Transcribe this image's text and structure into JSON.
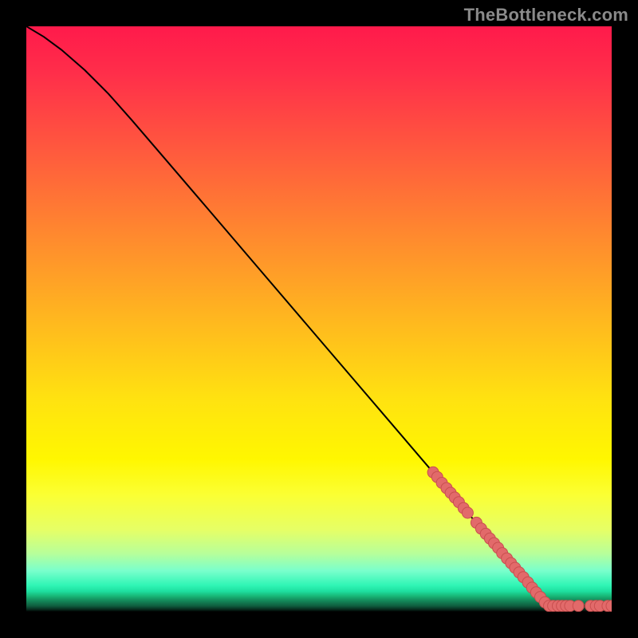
{
  "attribution": "TheBottleneck.com",
  "colors": {
    "marker_fill": "#e26a6a",
    "marker_stroke": "#c94f4f",
    "curve": "#000000",
    "page_bg": "#000000"
  },
  "chart_data": {
    "type": "line",
    "title": "",
    "xlabel": "",
    "ylabel": "",
    "xlim": [
      0,
      100
    ],
    "ylim": [
      0,
      100
    ],
    "grid": false,
    "legend": false,
    "curve": [
      {
        "x": 0,
        "y": 100
      },
      {
        "x": 3,
        "y": 98.2
      },
      {
        "x": 6,
        "y": 96.0
      },
      {
        "x": 10,
        "y": 92.5
      },
      {
        "x": 14,
        "y": 88.5
      },
      {
        "x": 18,
        "y": 84.0
      },
      {
        "x": 24,
        "y": 77.0
      },
      {
        "x": 30,
        "y": 70.0
      },
      {
        "x": 40,
        "y": 58.3
      },
      {
        "x": 50,
        "y": 46.6
      },
      {
        "x": 60,
        "y": 34.9
      },
      {
        "x": 70,
        "y": 23.2
      },
      {
        "x": 76,
        "y": 16.2
      },
      {
        "x": 80,
        "y": 11.6
      },
      {
        "x": 84,
        "y": 6.9
      },
      {
        "x": 87,
        "y": 3.4
      },
      {
        "x": 89,
        "y": 1.8
      },
      {
        "x": 90.5,
        "y": 1.0
      },
      {
        "x": 92,
        "y": 1.0
      },
      {
        "x": 95,
        "y": 1.0
      },
      {
        "x": 100,
        "y": 1.0
      }
    ],
    "markers": [
      {
        "x": 69.5,
        "y": 23.8
      },
      {
        "x": 70.2,
        "y": 23.0
      },
      {
        "x": 71.0,
        "y": 22.0
      },
      {
        "x": 71.8,
        "y": 21.1
      },
      {
        "x": 72.5,
        "y": 20.3
      },
      {
        "x": 73.2,
        "y": 19.5
      },
      {
        "x": 73.9,
        "y": 18.7
      },
      {
        "x": 74.7,
        "y": 17.7
      },
      {
        "x": 75.4,
        "y": 16.9
      },
      {
        "x": 76.9,
        "y": 15.2
      },
      {
        "x": 77.7,
        "y": 14.2
      },
      {
        "x": 78.5,
        "y": 13.3
      },
      {
        "x": 79.2,
        "y": 12.5
      },
      {
        "x": 79.9,
        "y": 11.7
      },
      {
        "x": 80.6,
        "y": 10.9
      },
      {
        "x": 81.3,
        "y": 10.0
      },
      {
        "x": 82.1,
        "y": 9.1
      },
      {
        "x": 82.8,
        "y": 8.3
      },
      {
        "x": 83.5,
        "y": 7.5
      },
      {
        "x": 84.2,
        "y": 6.7
      },
      {
        "x": 84.9,
        "y": 5.9
      },
      {
        "x": 85.7,
        "y": 5.0
      },
      {
        "x": 86.4,
        "y": 4.1
      },
      {
        "x": 87.1,
        "y": 3.3
      },
      {
        "x": 87.8,
        "y": 2.5
      },
      {
        "x": 88.6,
        "y": 1.6
      },
      {
        "x": 89.3,
        "y": 1.0
      },
      {
        "x": 90.0,
        "y": 1.0
      },
      {
        "x": 90.8,
        "y": 1.0
      },
      {
        "x": 91.5,
        "y": 1.0
      },
      {
        "x": 92.2,
        "y": 1.0
      },
      {
        "x": 92.9,
        "y": 1.0
      },
      {
        "x": 94.3,
        "y": 1.0
      },
      {
        "x": 96.4,
        "y": 1.0
      },
      {
        "x": 97.3,
        "y": 1.0
      },
      {
        "x": 98.0,
        "y": 1.0
      },
      {
        "x": 99.3,
        "y": 1.0
      },
      {
        "x": 100.0,
        "y": 1.0
      }
    ]
  }
}
